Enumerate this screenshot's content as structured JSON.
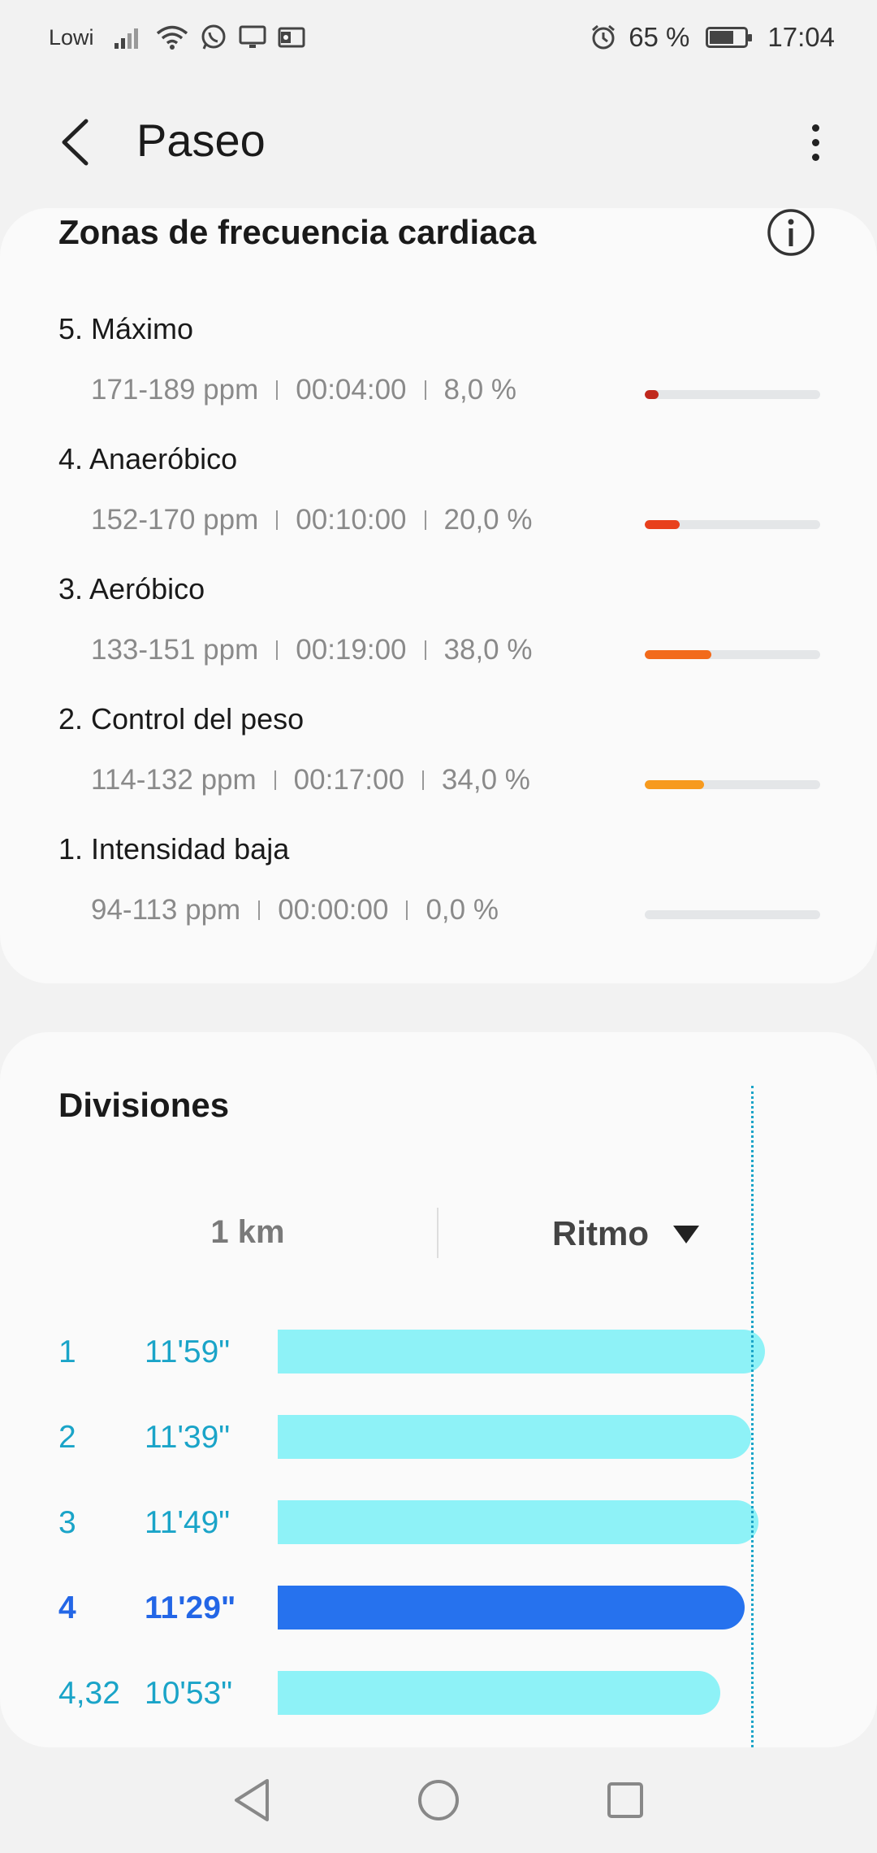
{
  "status": {
    "carrier": "Lowi",
    "battery": "65 %",
    "time": "17:04"
  },
  "header": {
    "title": "Paseo"
  },
  "heart_zones": {
    "title": "Zonas de frecuencia cardiaca",
    "zones": [
      {
        "name": "5. Máximo",
        "range": "171-189 ppm",
        "time": "00:04:00",
        "percent": "8,0 %",
        "fill_fraction": 0.08,
        "color": "#c0281c"
      },
      {
        "name": "4. Anaeróbico",
        "range": "152-170 ppm",
        "time": "00:10:00",
        "percent": "20,0 %",
        "fill_fraction": 0.2,
        "color": "#e8401c"
      },
      {
        "name": "3. Aeróbico",
        "range": "133-151 ppm",
        "time": "00:19:00",
        "percent": "38,0 %",
        "fill_fraction": 0.38,
        "color": "#f26a1b"
      },
      {
        "name": "2. Control del peso",
        "range": "114-132 ppm",
        "time": "00:17:00",
        "percent": "34,0 %",
        "fill_fraction": 0.34,
        "color": "#f79a1e"
      },
      {
        "name": "1. Intensidad baja",
        "range": "94-113 ppm",
        "time": "00:00:00",
        "percent": "0,0 %",
        "fill_fraction": 0.0,
        "color": "#f7c21e"
      }
    ]
  },
  "divisions": {
    "title": "Divisiones",
    "unit": "1 km",
    "metric": "Ritmo",
    "splits": [
      {
        "num": "1",
        "pace": "11'59\"",
        "pace_seconds": 719,
        "best": false
      },
      {
        "num": "2",
        "pace": "11'39\"",
        "pace_seconds": 699,
        "best": false
      },
      {
        "num": "3",
        "pace": "11'49\"",
        "pace_seconds": 709,
        "best": false
      },
      {
        "num": "4",
        "pace": "11'29\"",
        "pace_seconds": 689,
        "best": true
      },
      {
        "num": "4,32",
        "pace": "10'53\"",
        "pace_seconds": 653,
        "best": false
      }
    ]
  },
  "colors": {
    "accent": "#1aa4c8",
    "best_split": "#2672ee",
    "split_bar": "#8ef2f7"
  }
}
